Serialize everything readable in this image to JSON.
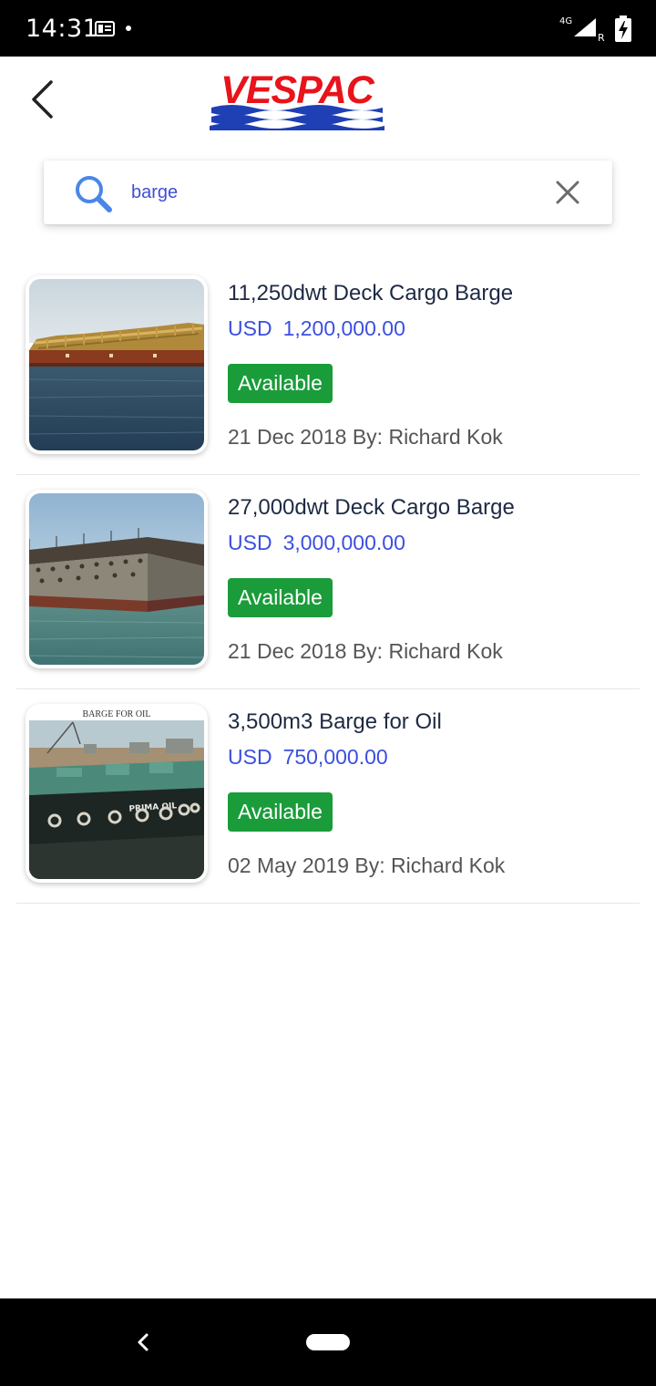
{
  "status_bar": {
    "time": "14:31",
    "network": "4G",
    "roaming": "R"
  },
  "header": {
    "logo_text": "VESPAC",
    "brand_color": "#e8131b",
    "wave_color": "#1f3fb5"
  },
  "search": {
    "query": "barge",
    "icon": "search-icon",
    "clear_icon": "close-icon"
  },
  "listings": [
    {
      "title": "11,250dwt Deck Cargo Barge",
      "currency": "USD",
      "price": "1,200,000.00",
      "status": "Available",
      "date": "21 Dec 2018",
      "by_label": "By:",
      "author": "Richard Kok"
    },
    {
      "title": "27,000dwt Deck Cargo Barge",
      "currency": "USD",
      "price": "3,000,000.00",
      "status": "Available",
      "date": "21 Dec 2018",
      "by_label": "By:",
      "author": "Richard Kok"
    },
    {
      "title": "3,500m3 Barge for Oil",
      "currency": "USD",
      "price": "750,000.00",
      "status": "Available",
      "date": "02 May 2019",
      "by_label": "By:",
      "author": "Richard Kok",
      "image_caption": "BARGE FOR OIL",
      "hull_text": "PRIMA OIL"
    }
  ],
  "colors": {
    "accent": "#3b4fe0",
    "available": "#1a9c3a",
    "title": "#1e2a44"
  }
}
